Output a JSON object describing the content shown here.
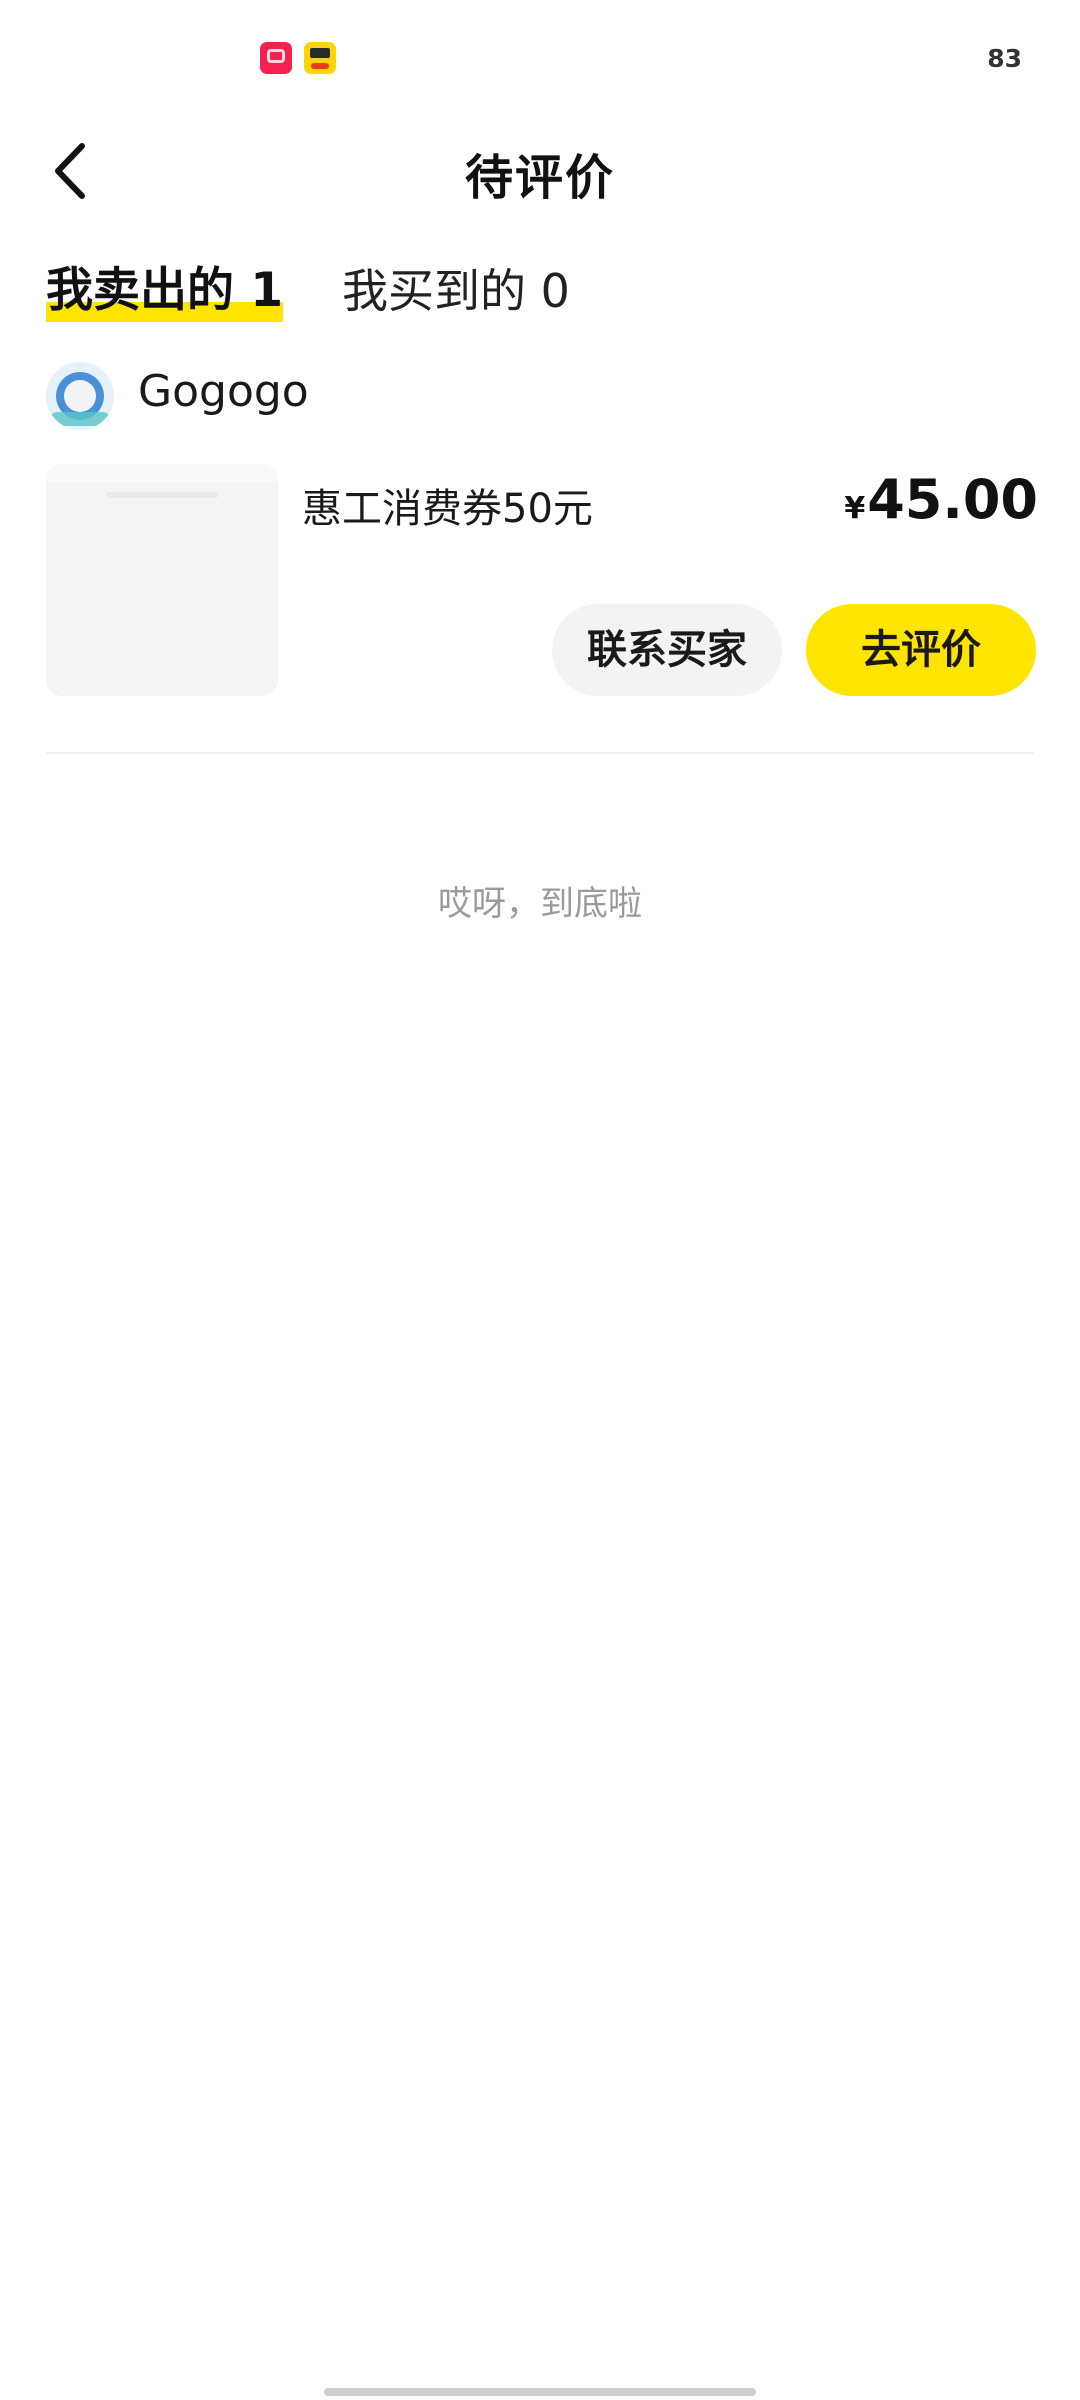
{
  "status_bar": {
    "battery": "83",
    "icons": [
      "taobao-app-icon",
      "xianyu-app-icon"
    ]
  },
  "header": {
    "title": "待评价",
    "back_icon": "chevron-left-icon"
  },
  "tabs": [
    {
      "label": "我卖出的 1",
      "active": true
    },
    {
      "label": "我买到的 0",
      "active": false
    }
  ],
  "order": {
    "seller_name": "Gogogo",
    "product_title": "惠工消费券50元",
    "currency": "¥",
    "price": "45.00",
    "contact_button": "联系买家",
    "review_button": "去评价"
  },
  "footer_message": "哎呀，到底啦",
  "colors": {
    "accent": "#ffe400",
    "text_primary": "#111111",
    "text_muted": "#9a9a9a"
  }
}
